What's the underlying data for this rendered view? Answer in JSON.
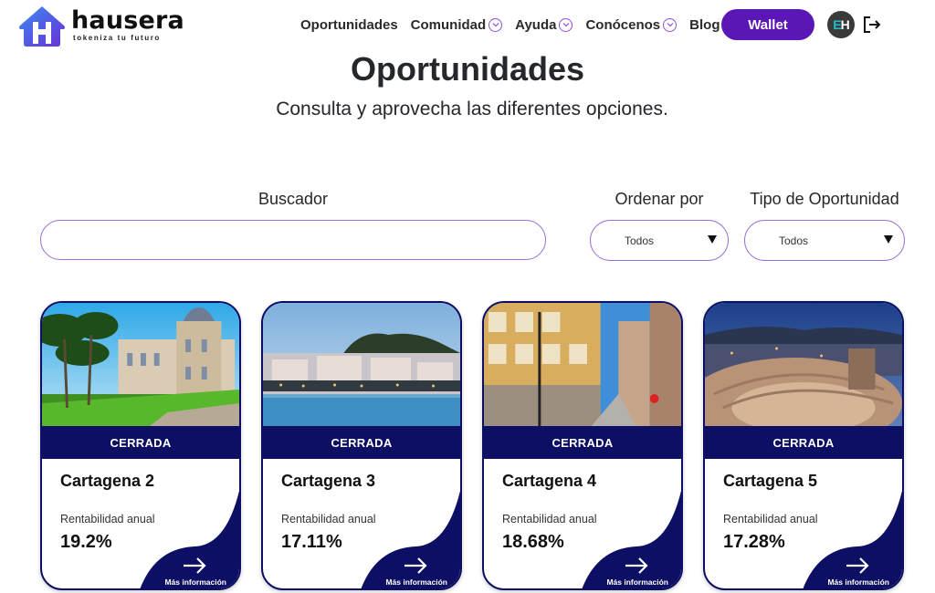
{
  "brand": {
    "name": "hausera",
    "tagline": "tokeniza tu futuro",
    "primary_color": "#5b17b5",
    "navy_color": "#0c0f63"
  },
  "nav": {
    "items": [
      {
        "label": "Oportunidades",
        "has_dropdown": false
      },
      {
        "label": "Comunidad",
        "has_dropdown": true
      },
      {
        "label": "Ayuda",
        "has_dropdown": true
      },
      {
        "label": "Conócenos",
        "has_dropdown": true
      },
      {
        "label": "Blog",
        "has_dropdown": false
      }
    ],
    "wallet_label": "Wallet",
    "avatar_initials_1": "E",
    "avatar_initials_2": "H",
    "logout_icon": "logout-icon"
  },
  "header": {
    "title": "Oportunidades",
    "subtitle": "Consulta y aprovecha las diferentes opciones."
  },
  "filters": {
    "search_label": "Buscador",
    "search_value": "",
    "search_placeholder": "",
    "sort_label": "Ordenar por",
    "sort_value": "Todos",
    "type_label": "Tipo de Oportunidad",
    "type_value": "Todos"
  },
  "cards": [
    {
      "status": "CERRADA",
      "title": "Cartagena 2",
      "rent_label": "Rentabilidad anual",
      "rent_value": "19.2%",
      "more_label": "Más información",
      "image": "town-hall-palace-with-palm-trees"
    },
    {
      "status": "CERRADA",
      "title": "Cartagena 3",
      "rent_label": "Rentabilidad anual",
      "rent_value": "17.11%",
      "more_label": "Más información",
      "image": "waterfront-city-at-dusk"
    },
    {
      "status": "CERRADA",
      "title": "Cartagena 4",
      "rent_label": "Rentabilidad anual",
      "rent_value": "18.68%",
      "more_label": "Más información",
      "image": "yellow-building-street"
    },
    {
      "status": "CERRADA",
      "title": "Cartagena 5",
      "rent_label": "Rentabilidad anual",
      "rent_value": "17.28%",
      "more_label": "Más información",
      "image": "roman-theatre-at-night"
    }
  ]
}
